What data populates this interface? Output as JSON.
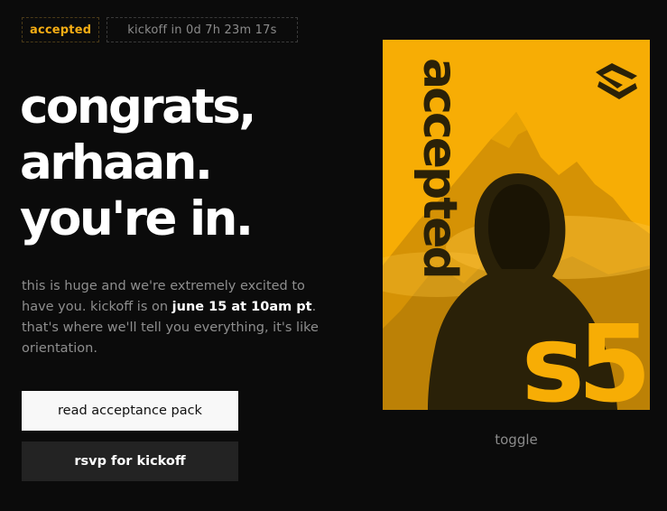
{
  "badges": {
    "status": "accepted",
    "countdown": "kickoff in 0d 7h 23m 17s"
  },
  "headline": {
    "line1": "congrats,",
    "line2": "arhaan.",
    "line3": "you're in."
  },
  "body": {
    "text_before": "this is huge and we're extremely excited to have you. kickoff is on ",
    "highlight": "june 15 at 10am pt",
    "text_after": ". that's where we'll tell you everything, it's like orientation."
  },
  "buttons": {
    "primary": "read acceptance pack",
    "secondary": "rsvp for kickoff"
  },
  "poster": {
    "vertical_text": "accepted",
    "season": "s5",
    "logo_icon": "chevron-logo-icon"
  },
  "toggle_label": "toggle",
  "colors": {
    "background": "#0b0b0b",
    "accent": "#f5ad14",
    "poster_yellow": "#f7ad05",
    "poster_dark": "#2a2108",
    "muted_text": "#8e8e8e"
  }
}
